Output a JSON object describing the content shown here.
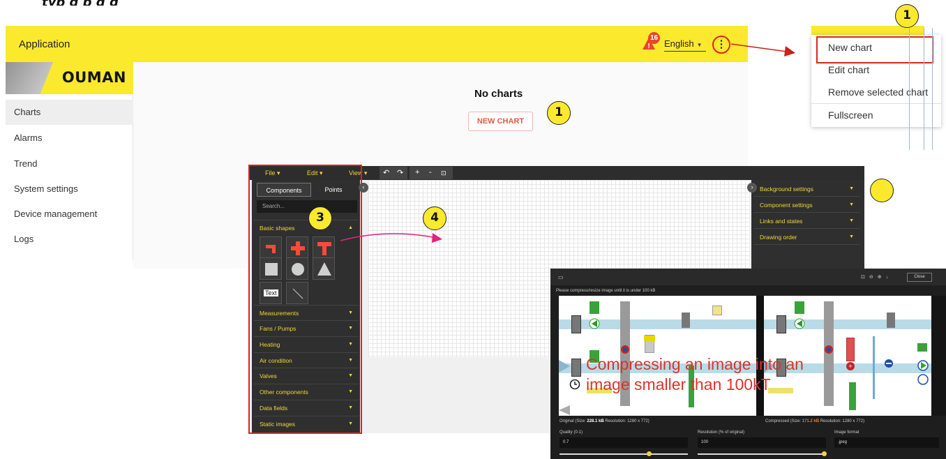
{
  "app": {
    "title": "Application",
    "notification_count": "16",
    "language": "English",
    "logo_text": "OUMAN",
    "accent_color": "#fbe92e"
  },
  "sidebar": {
    "items": [
      {
        "label": "Charts"
      },
      {
        "label": "Alarms"
      },
      {
        "label": "Trend"
      },
      {
        "label": "System settings"
      },
      {
        "label": "Device management"
      },
      {
        "label": "Logs"
      }
    ]
  },
  "main": {
    "empty_title": "No charts",
    "new_chart_button": "NEW CHART"
  },
  "menu": {
    "items": [
      {
        "label": "New chart"
      },
      {
        "label": "Edit chart"
      },
      {
        "label": "Remove selected chart"
      },
      {
        "label": "Fullscreen"
      }
    ]
  },
  "markers": {
    "one": "1",
    "three": "3",
    "four": "4"
  },
  "editor": {
    "menus": [
      "File",
      "Edit",
      "View"
    ],
    "tabs": [
      "Components",
      "Points"
    ],
    "search_placeholder": "Search...",
    "basic_shapes": "Basic shapes",
    "text_shape": "Text",
    "categories": [
      "Measurements",
      "Fans / Pumps",
      "Heating",
      "Air condition",
      "Valves",
      "Other components",
      "Data fields",
      "Static images"
    ],
    "right_panel": [
      "Background settings",
      "Component settings",
      "Links and states",
      "Drawing order"
    ]
  },
  "dialog": {
    "close": "Close",
    "hint": "Please compress/resize image until it is under 100 kB",
    "original_prefix": "Original (Size: ",
    "original_size": "228.1 kB",
    "original_suffix": " Resolution: 1280 x 772)",
    "compressed_prefix": "Compressed (Size: ",
    "compressed_size": "171.2 kB",
    "compressed_suffix": " Resolution: 1280 x 772)",
    "quality_label": "Quality (0-1)",
    "quality_value": "0.7",
    "resolution_label": "Resolution (% of original)",
    "resolution_value": "100",
    "format_label": "Image format",
    "format_value": ".jpeg",
    "caption": "Compressing an image into an image smaller than 100kT"
  }
}
